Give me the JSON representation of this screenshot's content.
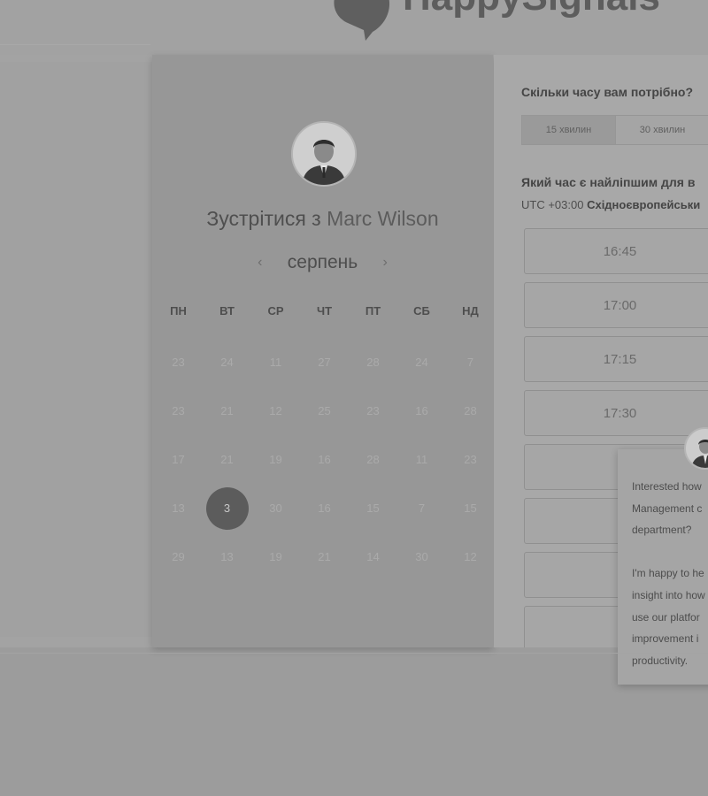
{
  "brand": {
    "name": "HappySignals"
  },
  "calendar": {
    "title_prefix": "Зустрітися з",
    "host_name": "Marc Wilson",
    "month": "серпень",
    "prev_arrow": "‹",
    "next_arrow": "›",
    "weekdays": [
      "ПН",
      "ВТ",
      "СР",
      "ЧТ",
      "ПТ",
      "СБ",
      "НД"
    ],
    "weeks": [
      [
        "23",
        "24",
        "11",
        "27",
        "28",
        "24",
        "7"
      ],
      [
        "23",
        "21",
        "12",
        "25",
        "23",
        "16",
        "28"
      ],
      [
        "17",
        "21",
        "19",
        "16",
        "28",
        "11",
        "23"
      ],
      [
        "13",
        "3",
        "30",
        "16",
        "15",
        "7",
        "15"
      ],
      [
        "29",
        "13",
        "19",
        "21",
        "14",
        "30",
        "12"
      ]
    ],
    "selected_day": "3"
  },
  "scheduler": {
    "duration_question": "Скільки часу вам потрібно?",
    "durations": [
      "15 хвилин",
      "30 хвилин"
    ],
    "time_question": "Який час є найліпшим для в",
    "timezone_offset": "UTC +03:00",
    "timezone_name": "Східноєвропейськи",
    "slots": [
      "16:45",
      "17:00",
      "17:15",
      "17:30",
      "",
      "",
      "",
      ""
    ]
  },
  "chat": {
    "lines_1": [
      "Interested how",
      "Management c",
      "department?"
    ],
    "lines_2": [
      "I'm happy to he",
      "insight into how",
      "use our platfor",
      "improvement i",
      "productivity."
    ]
  },
  "colors": {
    "selected_day_bg": "#5c5c5c",
    "panel_bg": "#979797",
    "logo_text": "#5d5d5d"
  }
}
